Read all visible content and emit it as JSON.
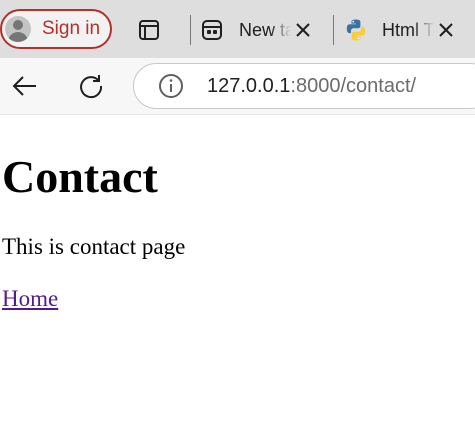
{
  "tabstrip": {
    "signin_label": "Sign in",
    "tabs": [
      {
        "title": "New tab",
        "favicon": "new-tab-icon"
      },
      {
        "title": "Html Template",
        "favicon": "python-icon"
      }
    ]
  },
  "toolbar": {
    "url_host": "127.0.0.1",
    "url_rest": ":8000/contact/"
  },
  "page": {
    "title": "Contact",
    "text": "This is contact page",
    "link": "Home"
  },
  "colors": {
    "signin_accent": "#b3312b",
    "link_visited": "#551a8b",
    "tabstrip_bg": "#dedede",
    "python_blue": "#3a72a4",
    "python_yellow": "#f6cd3d"
  }
}
